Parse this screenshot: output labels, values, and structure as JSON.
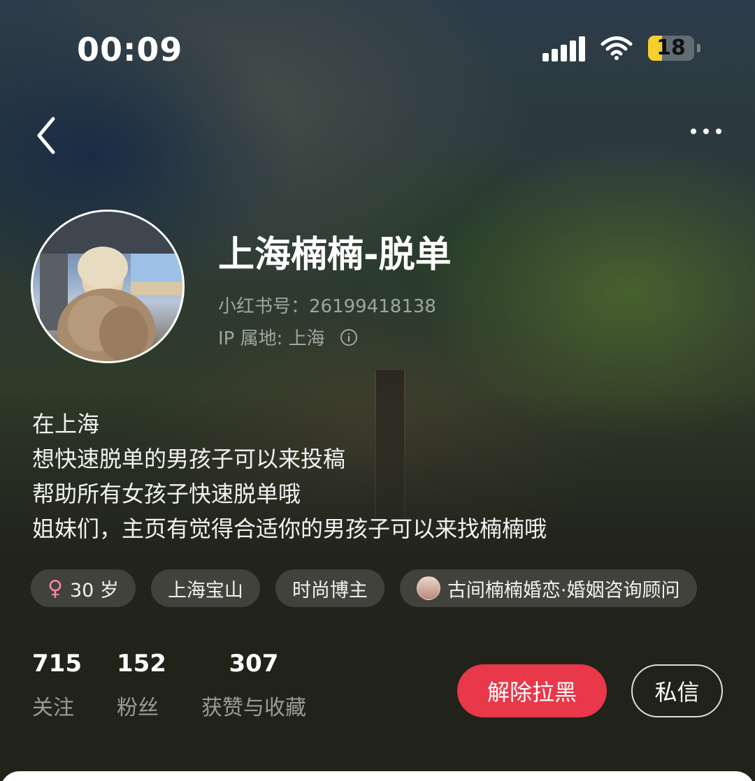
{
  "status_bar": {
    "time": "00:09",
    "battery_level": "18",
    "battery_color": "#f5cf2b"
  },
  "nav": {
    "back_icon": "chevron-left-icon",
    "more_icon": "ellipsis-icon"
  },
  "profile": {
    "nickname": "上海楠楠-脱单",
    "id_line": "小红书号：26199418138",
    "ip_line": "IP 属地: 上海",
    "bio": [
      "在上海",
      "想快速脱单的男孩子可以来投稿",
      "帮助所有女孩子快速脱单哦",
      "姐妹们，主页有觉得合适你的男孩子可以来找楠楠哦"
    ]
  },
  "tags": [
    {
      "icon": "female-icon",
      "label": "30 岁"
    },
    {
      "label": "上海宝山"
    },
    {
      "label": "时尚博主"
    },
    {
      "icon": "avatar",
      "label": "古间楠楠婚恋·婚姻咨询顾问"
    }
  ],
  "stats": [
    {
      "value": "715",
      "label": "关注"
    },
    {
      "value": "152",
      "label": "粉丝"
    },
    {
      "value": "307",
      "label": "获赞与收藏"
    }
  ],
  "actions": {
    "unblock_label": "解除拉黑",
    "message_label": "私信",
    "accent_color": "#e8384a"
  }
}
